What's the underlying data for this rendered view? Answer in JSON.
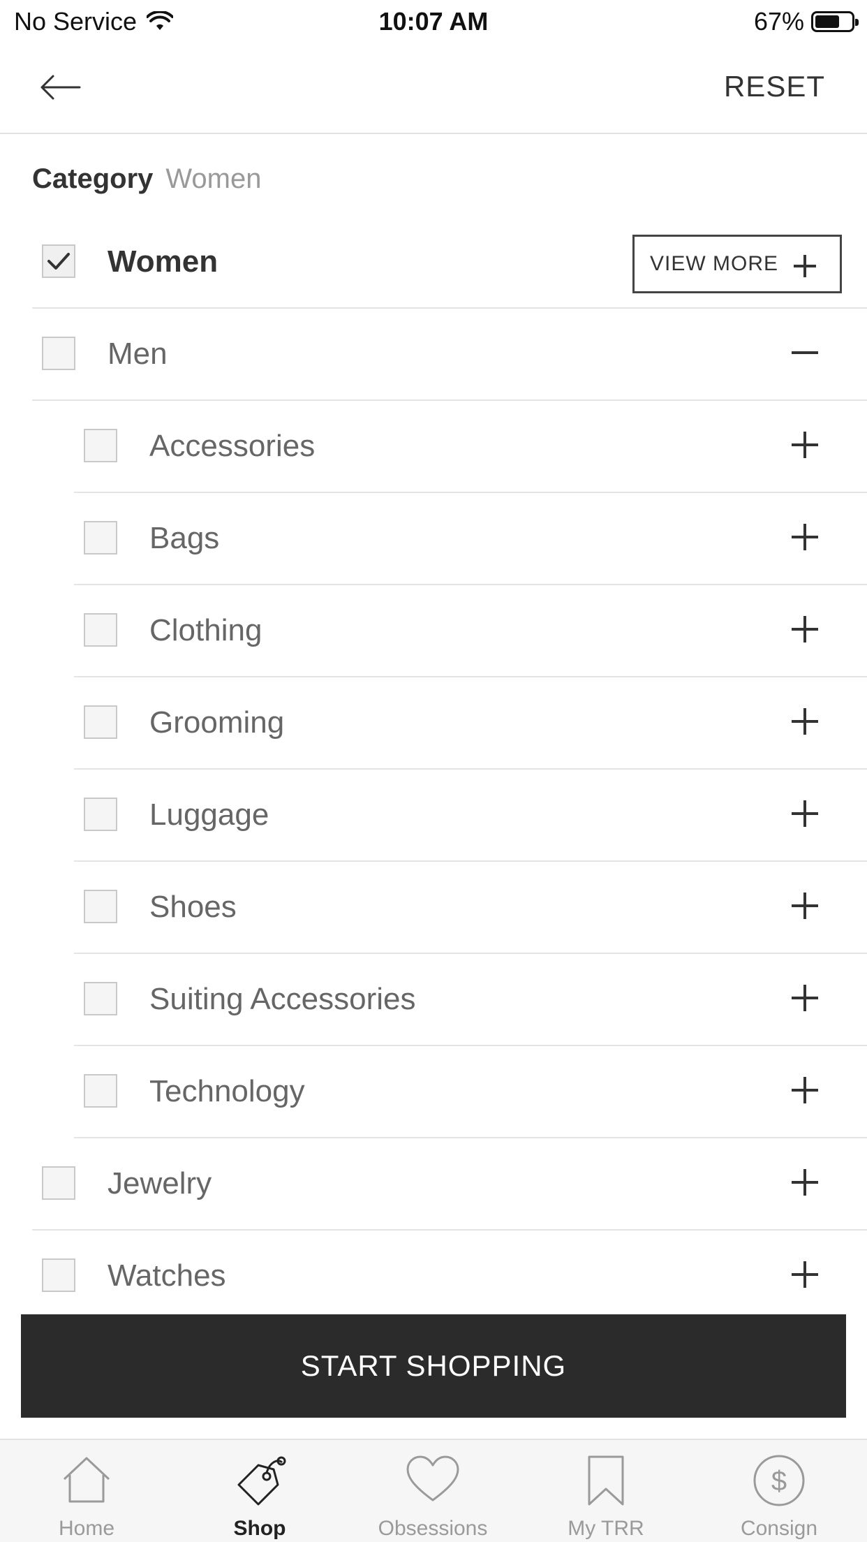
{
  "status": {
    "carrier": "No Service",
    "time": "10:07 AM",
    "battery": "67%",
    "battery_level": 0.67
  },
  "nav": {
    "reset_label": "RESET",
    "back_icon": "arrow-left-icon"
  },
  "category": {
    "title": "Category",
    "selected": "Women"
  },
  "view_more_label": "VIEW MORE",
  "items": [
    {
      "label": "Women",
      "checked": true,
      "expanded": false
    },
    {
      "label": "Men",
      "checked": false,
      "expanded": true
    },
    {
      "label": "Accessories",
      "checked": false,
      "expanded": false
    },
    {
      "label": "Bags",
      "checked": false,
      "expanded": false
    },
    {
      "label": "Clothing",
      "checked": false,
      "expanded": false
    },
    {
      "label": "Grooming",
      "checked": false,
      "expanded": false
    },
    {
      "label": "Luggage",
      "checked": false,
      "expanded": false
    },
    {
      "label": "Shoes",
      "checked": false,
      "expanded": false
    },
    {
      "label": "Suiting Accessories",
      "checked": false,
      "expanded": false
    },
    {
      "label": "Technology",
      "checked": false,
      "expanded": false
    },
    {
      "label": "Jewelry",
      "checked": false,
      "expanded": false
    },
    {
      "label": "Watches",
      "checked": false,
      "expanded": false
    }
  ],
  "start_label": "START SHOPPING",
  "tabs": [
    {
      "label": "Home",
      "icon": "home-icon",
      "active": false
    },
    {
      "label": "Shop",
      "icon": "shopping-tag-icon",
      "active": true
    },
    {
      "label": "Obsessions",
      "icon": "heart-icon",
      "active": false
    },
    {
      "label": "My TRR",
      "icon": "bookmark-icon",
      "active": false
    },
    {
      "label": "Consign",
      "icon": "dollar-circle-icon",
      "active": false
    }
  ]
}
